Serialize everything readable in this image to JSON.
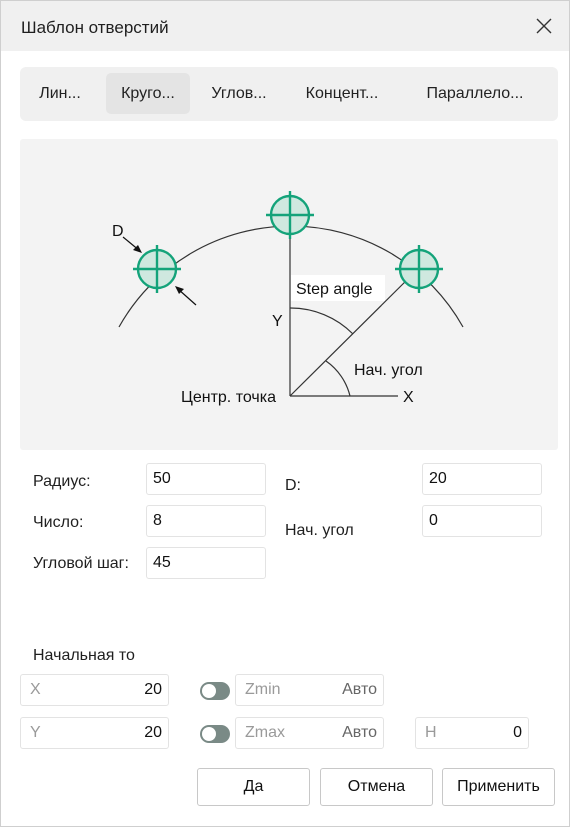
{
  "window": {
    "title": "Шаблон отверстий"
  },
  "tabs": [
    {
      "label": "Лин..."
    },
    {
      "label": "Круго..."
    },
    {
      "label": "Углов..."
    },
    {
      "label": "Концент..."
    },
    {
      "label": "Параллело..."
    }
  ],
  "diagram": {
    "label_d": "D",
    "label_step_angle": "Step angle",
    "label_y": "Y",
    "label_start_angle": "Нач. угол",
    "label_center": "Центр. точка",
    "label_x": "X"
  },
  "params": {
    "radius_label": "Радиус:",
    "radius_value": "50",
    "count_label": "Число:",
    "count_value": "8",
    "step_label": "Угловой шаг:",
    "step_value": "45",
    "d_label": "D:",
    "d_value": "20",
    "start_angle_label": "Нач. угол",
    "start_angle_value": "0"
  },
  "start_point": {
    "label": "Начальная то",
    "x_placeholder": "X",
    "x_value": "20",
    "y_placeholder": "Y",
    "y_value": "20",
    "zmin_placeholder": "Zmin",
    "zmin_value": "Авто",
    "zmax_placeholder": "Zmax",
    "zmax_value": "Авто",
    "h_placeholder": "H",
    "h_value": "0"
  },
  "buttons": {
    "ok": "Да",
    "cancel": "Отмена",
    "apply": "Применить"
  },
  "colors": {
    "accent": "#14a37a",
    "accent_fill": "#cfe8df",
    "toggle": "#7a8a86"
  }
}
